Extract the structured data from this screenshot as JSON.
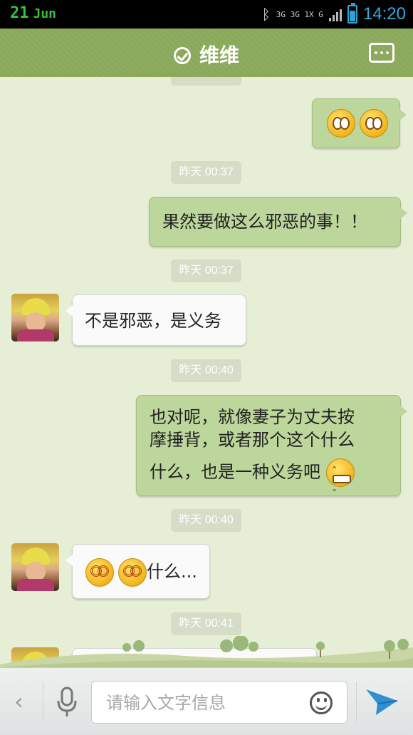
{
  "status_bar": {
    "day": "21",
    "month": "Jun",
    "network_label": "3G 3G 1X G",
    "time": "14:20"
  },
  "header": {
    "title": "维维"
  },
  "messages": [
    {
      "type": "outgoing",
      "emojis": [
        "eye-roll",
        "eye-roll"
      ]
    },
    {
      "type": "timestamp",
      "text": "昨天 00:37"
    },
    {
      "type": "outgoing",
      "text": "果然要做这么邪恶的事！！"
    },
    {
      "type": "timestamp",
      "text": "昨天 00:37"
    },
    {
      "type": "incoming",
      "text": "不是邪恶，是义务"
    },
    {
      "type": "timestamp",
      "text": "昨天 00:40"
    },
    {
      "type": "outgoing",
      "lines": [
        "也对呢，就像妻子为丈夫按",
        "摩捶背，或者那个这个什么",
        "什么，也是一种义务吧"
      ],
      "emoji": "grin"
    },
    {
      "type": "timestamp",
      "text": "昨天 00:40"
    },
    {
      "type": "incoming",
      "emojis": [
        "dizzy",
        "dizzy"
      ],
      "text": "什么..."
    },
    {
      "type": "timestamp",
      "text": "昨天 00:41"
    }
  ],
  "input": {
    "placeholder": "请输入文字信息"
  },
  "colors": {
    "header_green": "#8aa95a",
    "outgoing_bubble": "#bcd69b",
    "incoming_bubble": "#fafafa",
    "chat_background": "#e6eed6",
    "time_blue": "#38a8dc",
    "send_blue": "#2f8fd0"
  },
  "icons": [
    "check-icon",
    "more-icon",
    "back-chevron-icon",
    "microphone-icon",
    "smile-icon",
    "send-icon",
    "bluetooth-icon",
    "battery-icon",
    "signal-icon"
  ]
}
